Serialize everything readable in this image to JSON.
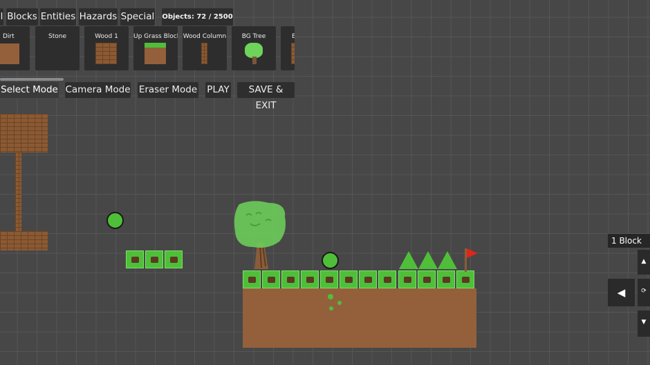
{
  "tabs": [
    {
      "label": "l"
    },
    {
      "label": "Blocks"
    },
    {
      "label": "Entities"
    },
    {
      "label": "Hazards"
    },
    {
      "label": "Special"
    }
  ],
  "objects_counter": "Objects: 72 / 2500",
  "palette": [
    {
      "label": "Dirt"
    },
    {
      "label": "Stone"
    },
    {
      "label": "Wood 1"
    },
    {
      "label": "Up Grass Block"
    },
    {
      "label": "Wood Column"
    },
    {
      "label": "BG Tree"
    },
    {
      "label": "B"
    }
  ],
  "modes": [
    {
      "label": "Select Mode"
    },
    {
      "label": "Camera Mode"
    },
    {
      "label": "Eraser Mode"
    },
    {
      "label": "PLAY"
    },
    {
      "label": "SAVE & EXIT"
    }
  ],
  "side_panel": {
    "size_label": "1 Block",
    "left_arrow": "◀"
  },
  "colors": {
    "grid_bg": "#474747",
    "grass": "#4fbf3a",
    "dirt": "#93603b",
    "flag": "#e0251b"
  }
}
